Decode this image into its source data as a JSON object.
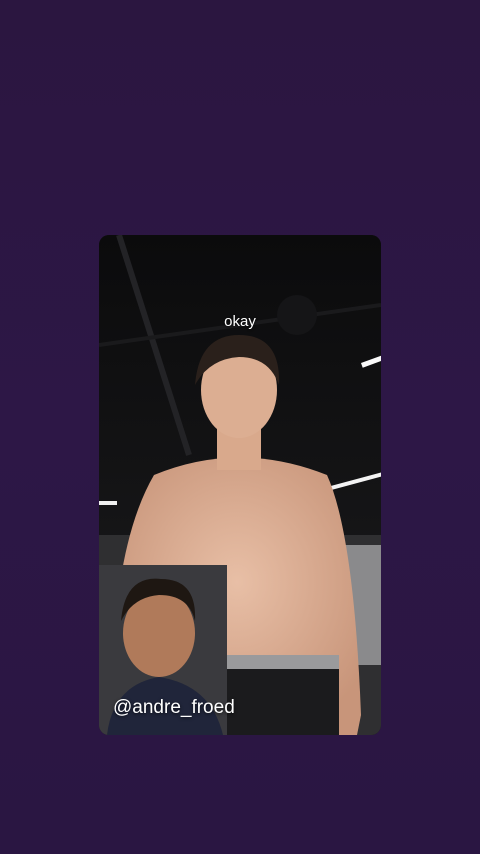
{
  "video": {
    "caption": "okay",
    "handle": "@andre_froed"
  },
  "colors": {
    "background": "#2b1640",
    "caption_text": "#ffffff"
  }
}
